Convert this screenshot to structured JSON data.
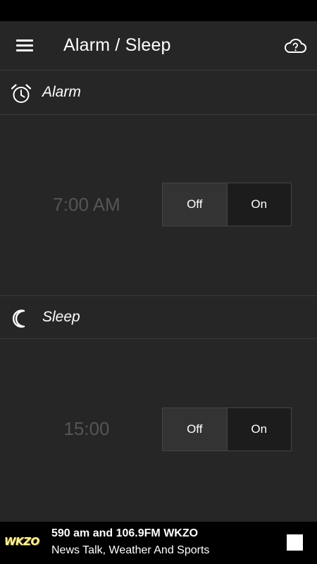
{
  "app_bar": {
    "title": "Alarm / Sleep",
    "menu_icon": "menu-icon",
    "cloud_icon": "cloud-help-icon"
  },
  "alarm": {
    "label": "Alarm",
    "icon": "alarm-clock-icon",
    "time": "7:00 AM",
    "off_label": "Off",
    "on_label": "On",
    "selected": "Off"
  },
  "sleep": {
    "label": "Sleep",
    "icon": "moon-icon",
    "time": "15:00",
    "off_label": "Off",
    "on_label": "On",
    "selected": "Off"
  },
  "player": {
    "logo": "WKZO",
    "title": "590 am and 106.9FM WKZO",
    "subtitle": "News Talk, Weather And Sports",
    "stop_icon": "stop-icon"
  },
  "colors": {
    "background": "#262626",
    "status_bar": "#000000",
    "divider": "#3a3a3a",
    "time_text": "#555555",
    "logo": "#fff3a8"
  }
}
